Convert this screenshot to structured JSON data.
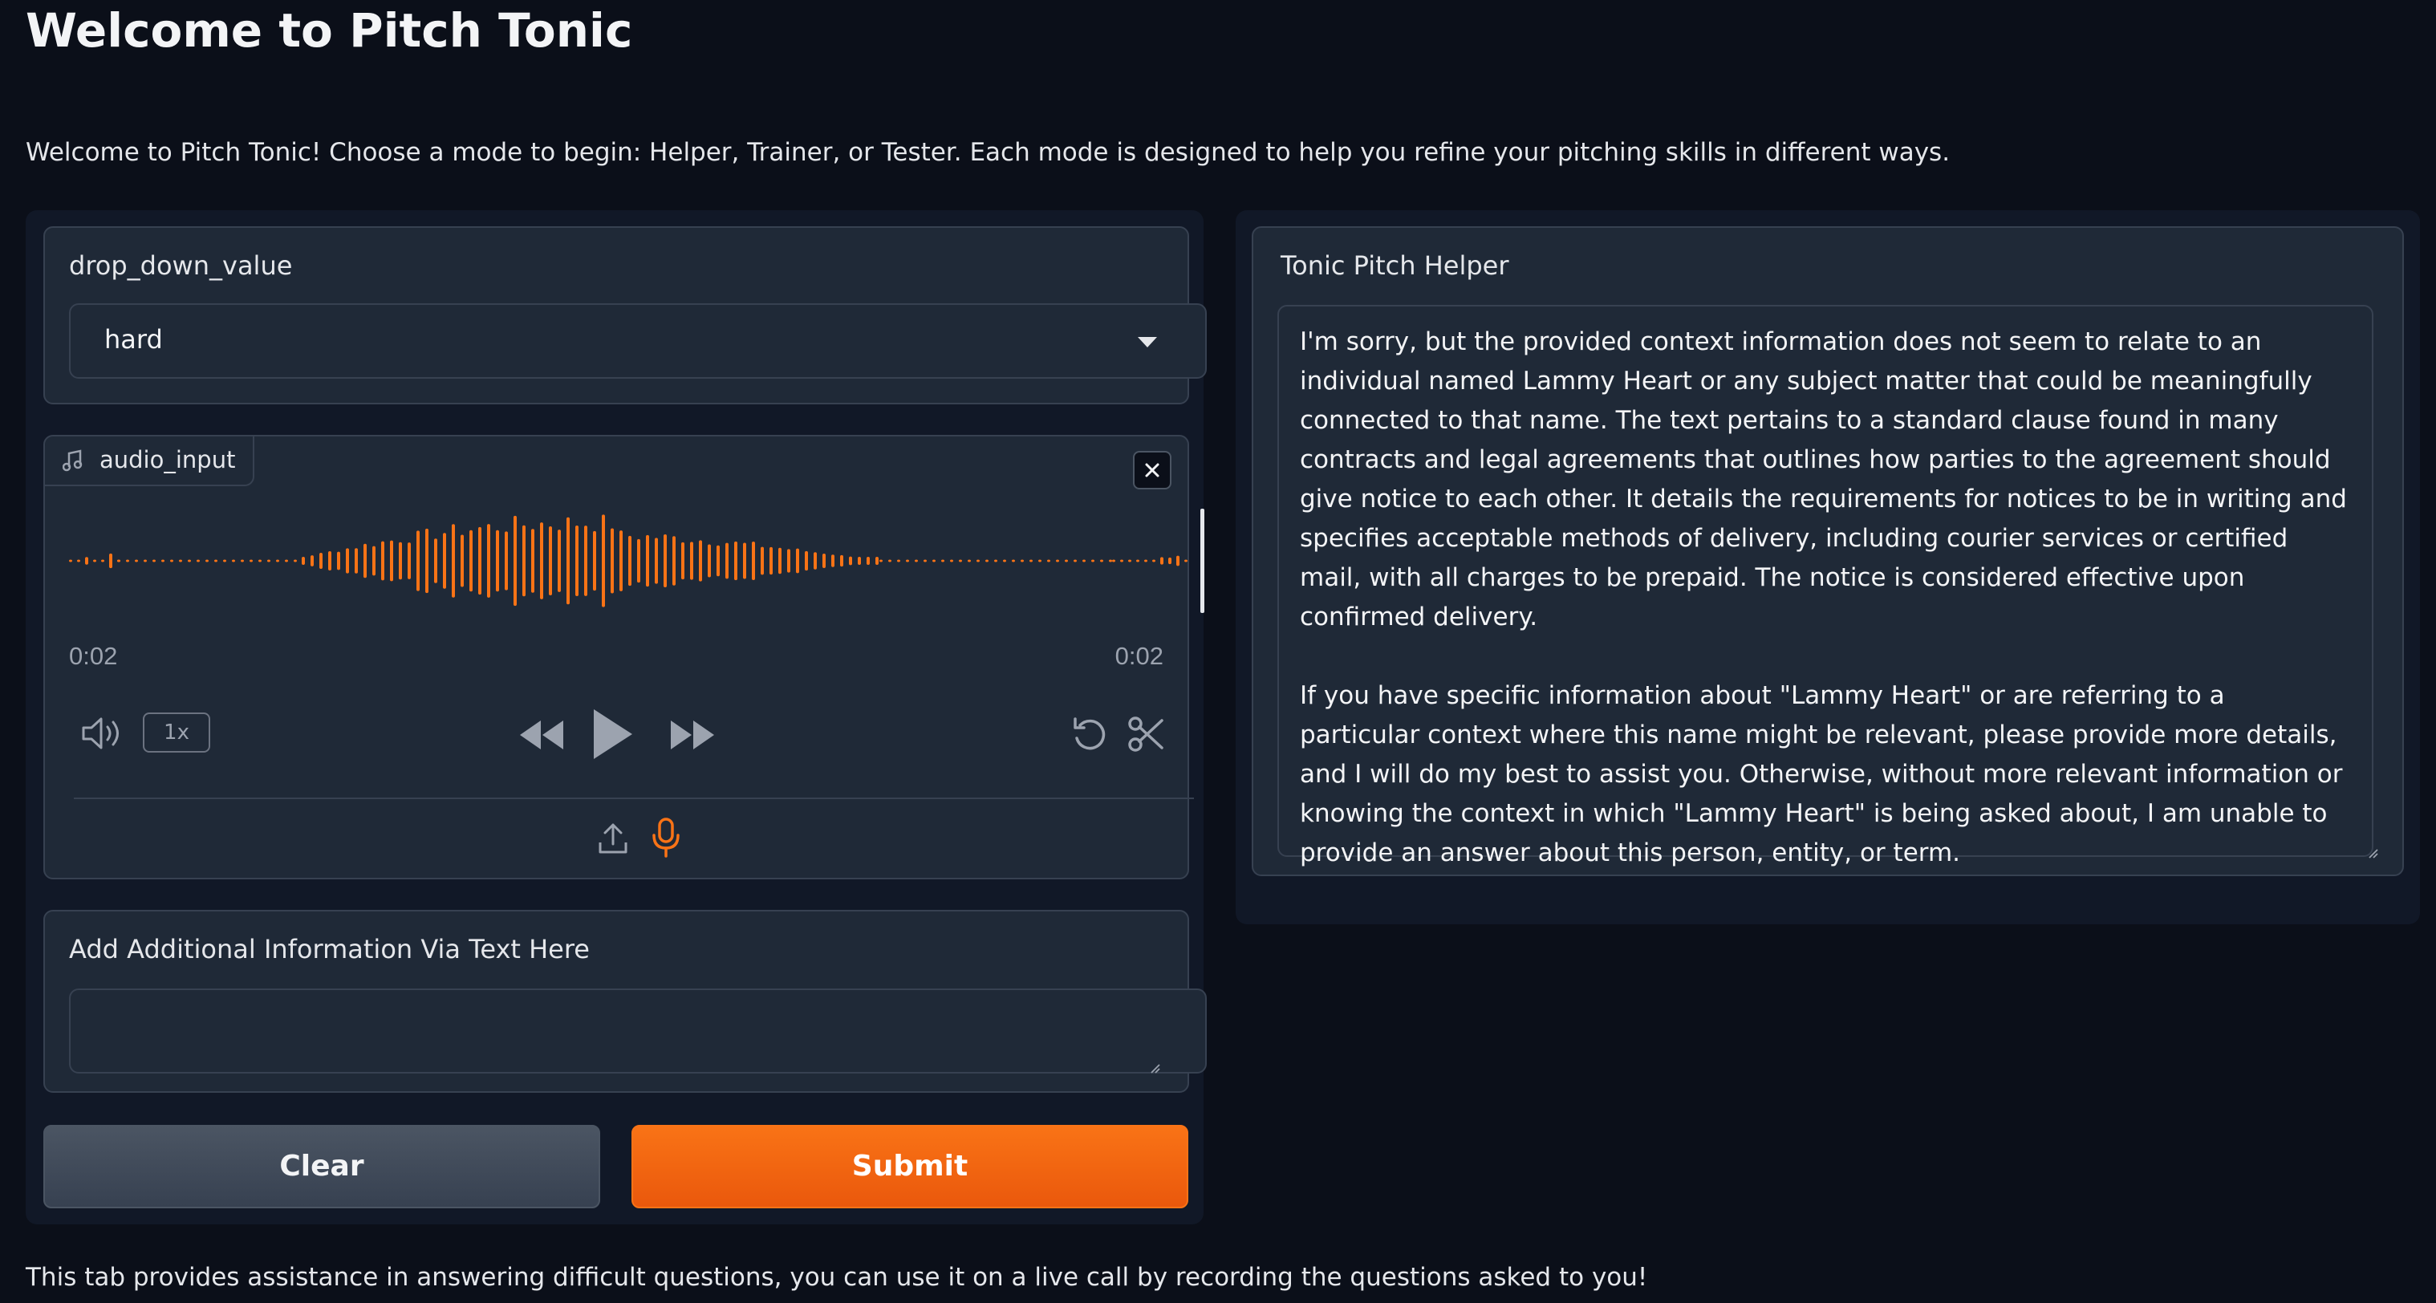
{
  "header": {
    "title": "Welcome to Pitch Tonic",
    "intro": "Welcome to Pitch Tonic! Choose a mode to begin: Helper, Trainer, or Tester. Each mode is designed to help you refine your pitching skills in different ways."
  },
  "dropdown": {
    "label": "drop_down_value",
    "value": "hard"
  },
  "audio": {
    "label": "audio_input",
    "current_time": "0:02",
    "duration": "0:02",
    "playback_rate": "1x",
    "accent_color": "#f97316"
  },
  "text_input": {
    "label": "Add Additional Information Via Text Here",
    "value": ""
  },
  "buttons": {
    "clear": "Clear",
    "submit": "Submit"
  },
  "output": {
    "label": "Tonic Pitch Helper",
    "text": "I'm sorry, but the provided context information does not seem to relate to an individual named Lammy Heart or any subject matter that could be meaningfully connected to that name. The text pertains to a standard clause found in many contracts and legal agreements that outlines how parties to the agreement should give notice to each other. It details the requirements for notices to be in writing and specifies acceptable methods of delivery, including courier services or certified mail, with all charges to be prepaid. The notice is considered effective upon confirmed delivery.\n\nIf you have specific information about \"Lammy Heart\" or are referring to a particular context where this name might be relevant, please provide more details, and I will do my best to assist you. Otherwise, without more relevant information or knowing the context in which \"Lammy Heart\" is being asked about, I am unable to provide an answer about this person, entity, or term."
  },
  "footer": {
    "text": "This tab provides assistance in answering difficult questions, you can use it on a live call by recording the questions asked to you!"
  }
}
